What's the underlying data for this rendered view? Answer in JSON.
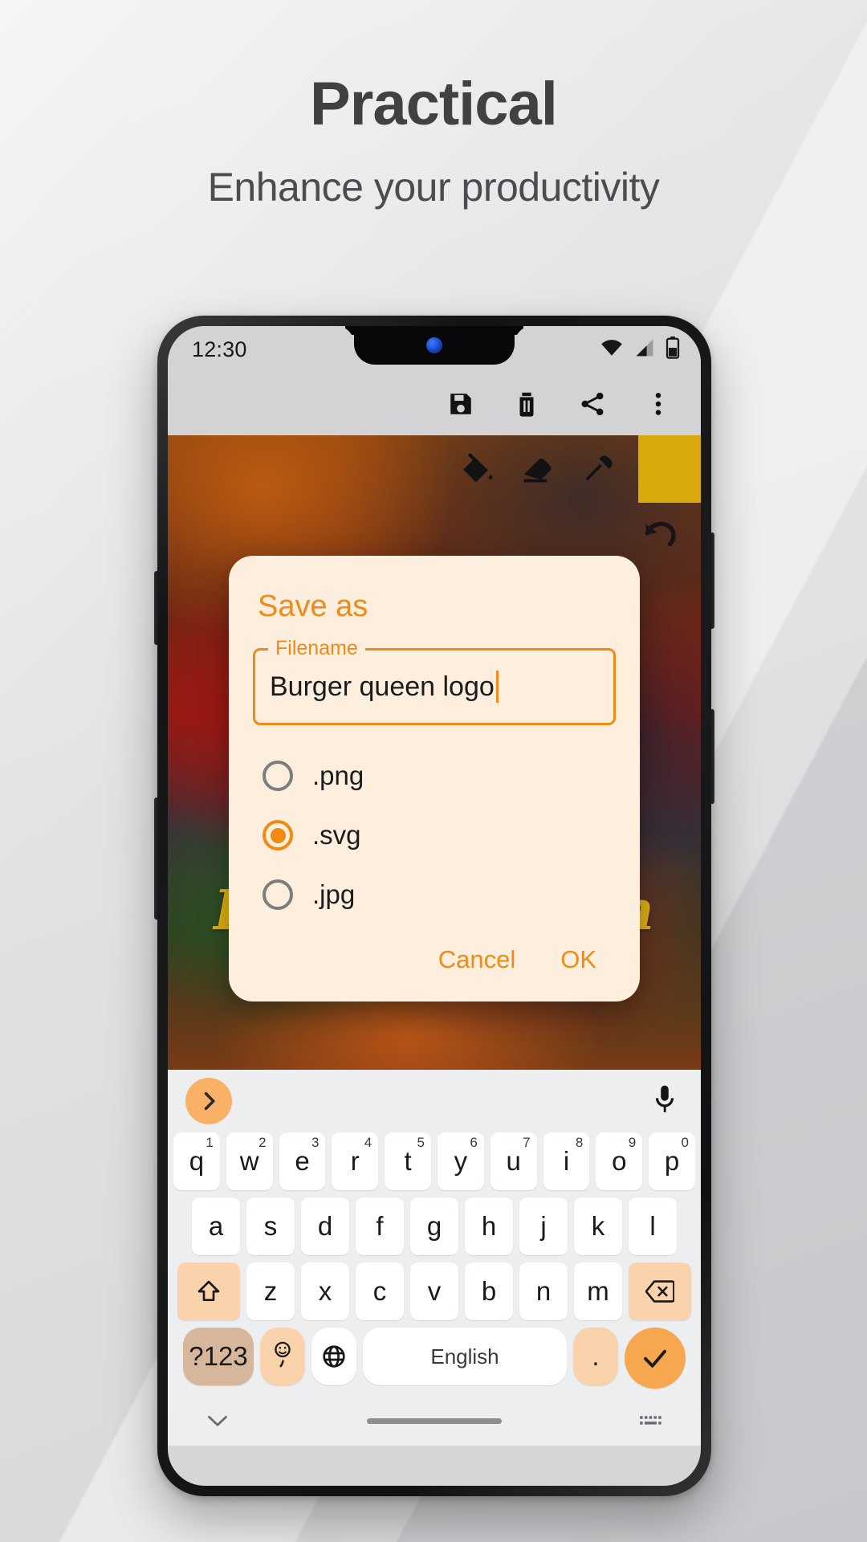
{
  "promo": {
    "headline": "Practical",
    "subheadline": "Enhance your productivity"
  },
  "colors": {
    "accent_orange": "#ef8b18",
    "dialog_bg": "#fdeede",
    "swatch_yellow": "#d9a90c",
    "key_accent": "#f6a74f"
  },
  "phone": {
    "status_bar": {
      "time": "12:30",
      "icons": [
        "wifi-icon",
        "cell-signal-icon",
        "battery-icon"
      ]
    },
    "app_toolbar": {
      "icons": [
        {
          "name": "save-icon",
          "label": "Save"
        },
        {
          "name": "delete-icon",
          "label": "Delete"
        },
        {
          "name": "share-icon",
          "label": "Share"
        },
        {
          "name": "overflow-menu-icon",
          "label": "More options"
        }
      ]
    },
    "draw_toolbar": {
      "icons": [
        {
          "name": "fill-bucket-icon",
          "label": "Fill"
        },
        {
          "name": "eraser-icon",
          "label": "Eraser"
        },
        {
          "name": "eyedropper-icon",
          "label": "Color picker"
        }
      ],
      "color_swatch": "#d9a90c",
      "undo": {
        "name": "undo-icon",
        "label": "Undo"
      }
    },
    "canvas": {
      "logo_text": "Burger Queen"
    }
  },
  "dialog": {
    "title": "Save as",
    "filename_label": "Filename",
    "filename_value": "Burger queen logo",
    "options": [
      {
        "label": ".png",
        "selected": false
      },
      {
        "label": ".svg",
        "selected": true
      },
      {
        "label": ".jpg",
        "selected": false
      }
    ],
    "cancel_label": "Cancel",
    "ok_label": "OK"
  },
  "keyboard": {
    "suggest_expand": "chevron-right-icon",
    "mic": "microphone-icon",
    "row1": [
      {
        "k": "q",
        "n": "1"
      },
      {
        "k": "w",
        "n": "2"
      },
      {
        "k": "e",
        "n": "3"
      },
      {
        "k": "r",
        "n": "4"
      },
      {
        "k": "t",
        "n": "5"
      },
      {
        "k": "y",
        "n": "6"
      },
      {
        "k": "u",
        "n": "7"
      },
      {
        "k": "i",
        "n": "8"
      },
      {
        "k": "o",
        "n": "9"
      },
      {
        "k": "p",
        "n": "0"
      }
    ],
    "row2": [
      "a",
      "s",
      "d",
      "f",
      "g",
      "h",
      "j",
      "k",
      "l"
    ],
    "row3": [
      "z",
      "x",
      "c",
      "v",
      "b",
      "n",
      "m"
    ],
    "shift": "shift-icon",
    "backspace": "backspace-icon",
    "symbols_label": "?123",
    "emoji_label": ",",
    "globe": "globe-icon",
    "space_label": "English",
    "period_label": ".",
    "enter": "checkmark-icon"
  }
}
